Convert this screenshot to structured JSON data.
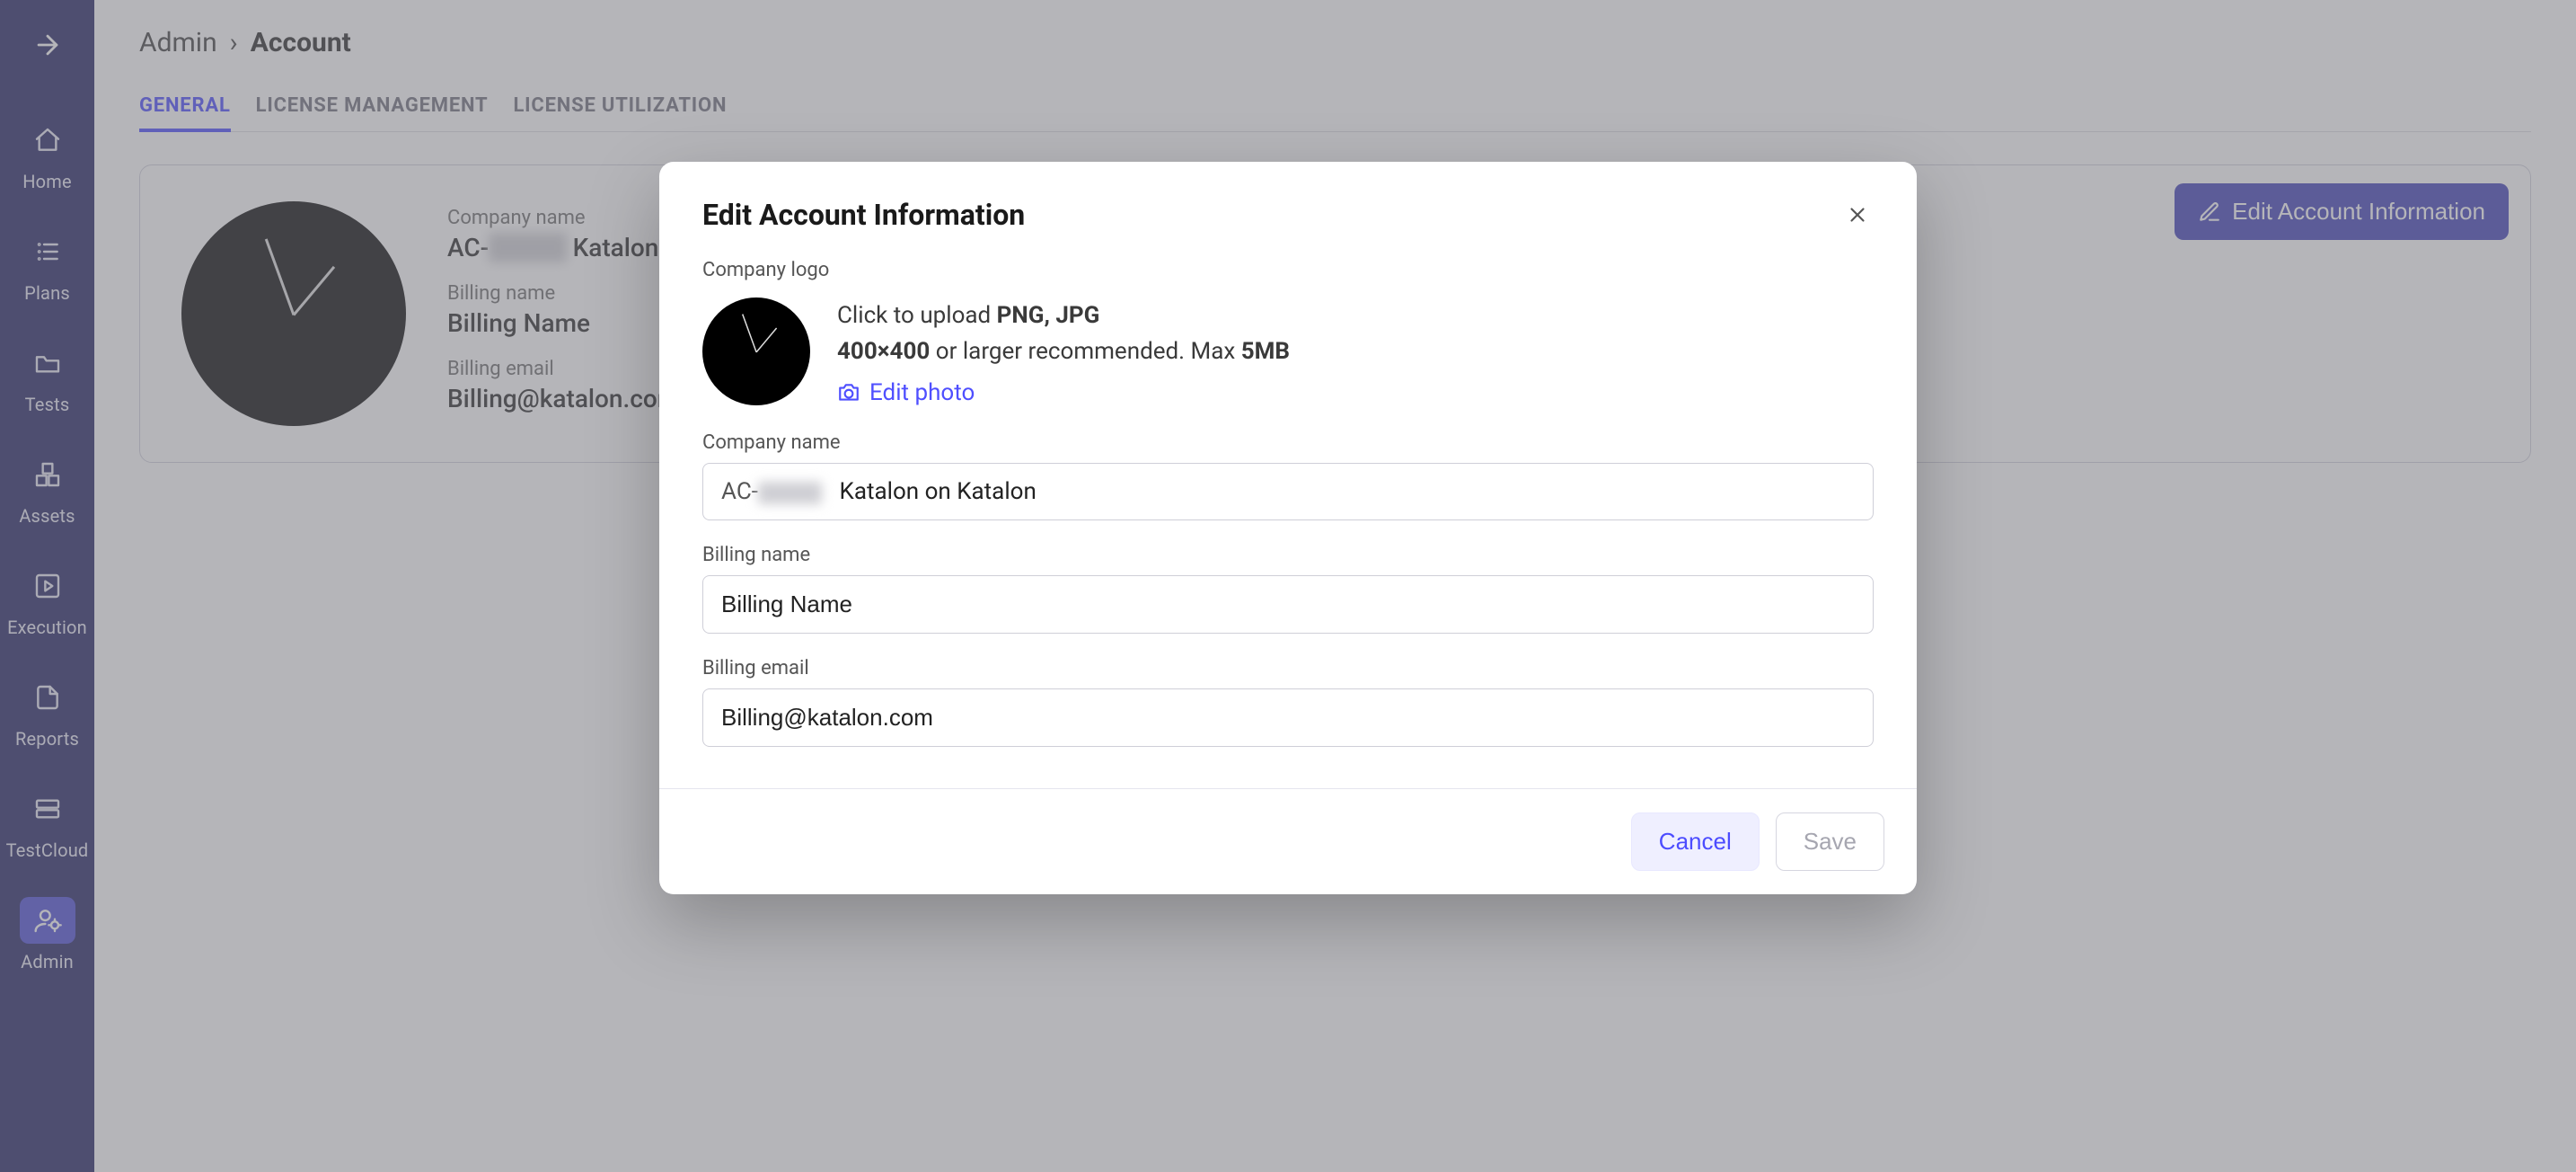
{
  "sidebar": {
    "items": [
      {
        "label": "Home"
      },
      {
        "label": "Plans"
      },
      {
        "label": "Tests"
      },
      {
        "label": "Assets"
      },
      {
        "label": "Execution"
      },
      {
        "label": "Reports"
      },
      {
        "label": "TestCloud"
      },
      {
        "label": "Admin"
      }
    ]
  },
  "breadcrumb": {
    "parent": "Admin",
    "current": "Account"
  },
  "tabs": [
    {
      "label": "GENERAL",
      "active": true
    },
    {
      "label": "LICENSE MANAGEMENT"
    },
    {
      "label": "LICENSE UTILIZATION"
    }
  ],
  "card": {
    "company_name_label": "Company name",
    "company_id_prefix": "AC-",
    "company_id_redacted": "xxxxx",
    "company_name_suffix": "Katalon on",
    "billing_name_label": "Billing name",
    "billing_name": "Billing Name",
    "billing_email_label": "Billing email",
    "billing_email": "Billing@katalon.com",
    "edit_button": "Edit Account Information"
  },
  "modal": {
    "title": "Edit Account Information",
    "logo_label": "Company logo",
    "upload_prefix": "Click to upload ",
    "upload_formats": "PNG, JPG",
    "upload_size": "400×400",
    "upload_mid": " or larger recommended. Max ",
    "upload_max": "5MB",
    "edit_photo": "Edit photo",
    "company_name_label": "Company name",
    "company_name_id": "AC-",
    "company_name_redacted": "xxxxx",
    "company_name_value": "Katalon on Katalon",
    "billing_name_label": "Billing name",
    "billing_name_value": "Billing Name",
    "billing_email_label": "Billing email",
    "billing_email_value": "Billing@katalon.com",
    "cancel": "Cancel",
    "save": "Save"
  }
}
